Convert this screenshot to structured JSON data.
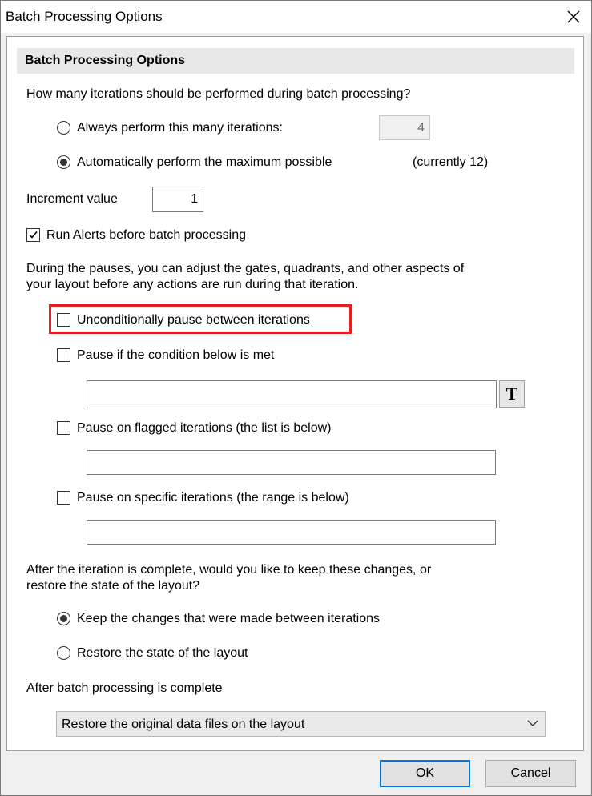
{
  "window": {
    "title": "Batch Processing Options",
    "close_icon": "close-icon"
  },
  "group": {
    "title": "Batch Processing Options"
  },
  "iterations": {
    "question": "How many iterations should be performed during batch processing?",
    "always_label": "Always perform this many iterations:",
    "always_value": "4",
    "auto_label": "Automatically perform the maximum possible",
    "currently": "(currently 12)",
    "selected": "auto"
  },
  "increment": {
    "label": "Increment value",
    "value": "1"
  },
  "run_alerts": {
    "label": "Run Alerts before batch processing",
    "checked": true
  },
  "pauses": {
    "description_line1": "During the pauses, you can adjust the gates, quadrants, and other aspects of",
    "description_line2": "your layout before any actions are run during that iteration.",
    "unconditional_label": "Unconditionally pause between iterations",
    "condition_label": "Pause if the condition below is met",
    "condition_value": "",
    "condition_button_label": "T",
    "flagged_label": "Pause on flagged iterations (the list is below)",
    "flagged_value": "",
    "specific_label": "Pause on specific iterations (the range is below)",
    "specific_value": ""
  },
  "after_iteration": {
    "question_line1": "After the iteration is complete, would you like to keep these changes, or",
    "question_line2": "restore the state of the layout?",
    "keep_label": "Keep the changes that were made between iterations",
    "restore_label": "Restore the state of the layout",
    "selected": "keep"
  },
  "after_batch": {
    "label": "After batch processing is complete",
    "selected_option": "Restore the original data files on the layout"
  },
  "buttons": {
    "ok": "OK",
    "cancel": "Cancel"
  },
  "colors": {
    "highlight": "#e32020",
    "default_button_border": "#0078d7"
  }
}
